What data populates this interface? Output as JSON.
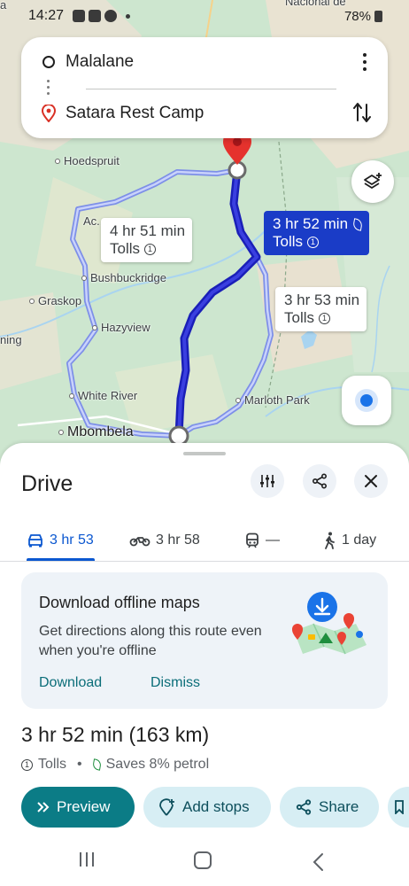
{
  "status_bar": {
    "time": "14:27",
    "battery": "78%"
  },
  "search": {
    "origin": "Malalane",
    "destination": "Satara Rest Camp"
  },
  "map_places": {
    "hoedspruit": "Hoedspruit",
    "acornhoek": "Ac...",
    "bushbuckridge": "Bushbuckridge",
    "graskop": "Graskop",
    "hazyview": "Hazyview",
    "white_river": "White River",
    "marloth_park": "Marloth Park",
    "mbombela": "Mbombela",
    "edge_left": "ning",
    "edge_top_left": "a",
    "edge_top_right": "Nacional de"
  },
  "route_labels": {
    "alt1": {
      "time": "4 hr 51 min",
      "tolls": "Tolls"
    },
    "main": {
      "time": "3 hr 52 min",
      "tolls": "Tolls"
    },
    "alt2": {
      "time": "3 hr 53 min",
      "tolls": "Tolls"
    }
  },
  "sheet": {
    "title": "Drive",
    "modes": [
      {
        "icon": "car-icon",
        "label": "3 hr 53",
        "active": true
      },
      {
        "icon": "motorcycle-icon",
        "label": "3 hr 58",
        "active": false
      },
      {
        "icon": "transit-icon",
        "label": "—",
        "active": false
      },
      {
        "icon": "walk-icon",
        "label": "1 day",
        "active": false
      }
    ],
    "promo": {
      "title": "Download offline maps",
      "description": "Get directions along this route even when you're offline",
      "download": "Download",
      "dismiss": "Dismiss"
    },
    "summary": "3 hr 52 min (163 km)",
    "tolls": "Tolls",
    "savings": "Saves 8% petrol",
    "actions": {
      "preview": "Preview",
      "add_stops": "Add stops",
      "share": "Share"
    }
  },
  "colors": {
    "route_main": "#1a1fb8",
    "route_alt": "#7d8fe8",
    "accent": "#0b7c86",
    "tab_active": "#0b57d0"
  }
}
